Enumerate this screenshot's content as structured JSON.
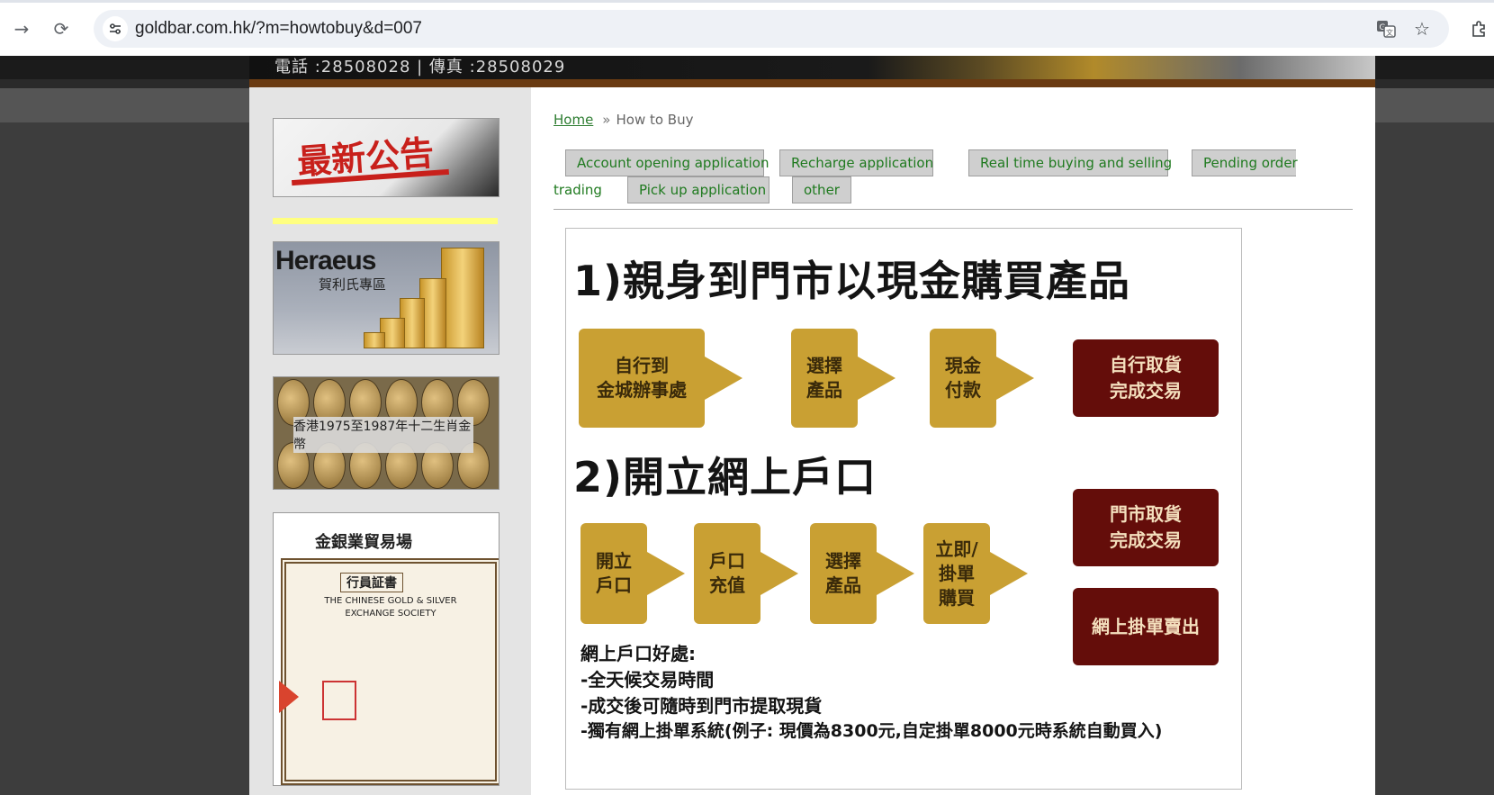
{
  "browser": {
    "url": "goldbar.com.hk/?m=howtobuy&d=007",
    "icons": [
      "forward-icon",
      "reload-icon",
      "site-info-icon",
      "translate-icon",
      "star-icon",
      "extensions-icon"
    ]
  },
  "site_header": {
    "contact": "電話 :28508028 | 傳真 :28508029"
  },
  "sidebar": {
    "notice_banner": "最新公告",
    "heraeus_brand": "Heraeus",
    "heraeus_sub": "賀利氏專區",
    "coins_caption": "香港1975至1987年十二生肖金幣",
    "cert_title": "金銀業貿易場",
    "cert_label": "行員証書",
    "cert_en_line1": "THE CHINESE GOLD & SILVER",
    "cert_en_line2": "EXCHANGE SOCIETY"
  },
  "breadcrumb": {
    "home": "Home",
    "separator": "»",
    "current": "How to Buy"
  },
  "tabs": [
    "Account opening application",
    "Recharge application",
    "Real time buying and selling",
    "Pending order",
    "trading",
    "Pick up application",
    "other"
  ],
  "guide": {
    "section1": {
      "heading": "1)親身到門市以現金購買產品",
      "steps": [
        "自行到\n金城辦事處",
        "選擇\n產品",
        "現金\n付款"
      ],
      "result": "自行取貨\n完成交易"
    },
    "section2": {
      "heading": "2)開立網上戶口",
      "steps": [
        "開立\n戶口",
        "戶口\n充值",
        "選擇\n產品",
        "立即/\n掛單\n購買"
      ],
      "results": [
        "門市取貨\n完成交易",
        "網上掛單賣出"
      ]
    },
    "benefits": {
      "title": "網上戶口好處:",
      "items": [
        "-全天候交易時間",
        "-成交後可隨時到門市提取現貨",
        "-獨有網上掛單系統(例子: 現價為8300元,自定掛單8000元時系統自動買入)"
      ]
    },
    "colors": {
      "step": "#c9a033",
      "result": "#640d0a"
    }
  }
}
